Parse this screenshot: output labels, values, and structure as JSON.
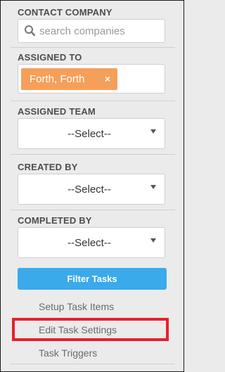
{
  "contact_company": {
    "label": "CONTACT COMPANY",
    "search_placeholder": "search companies"
  },
  "assigned_to": {
    "label": "ASSIGNED TO",
    "tag_label": "Forth, Forth",
    "tag_remove": "×"
  },
  "assigned_team": {
    "label": "ASSIGNED TEAM",
    "selected": "--Select--"
  },
  "created_by": {
    "label": "CREATED BY",
    "selected": "--Select--"
  },
  "completed_by": {
    "label": "COMPLETED BY",
    "selected": "--Select--"
  },
  "filter_button": "Filter Tasks",
  "links": [
    "Setup Task Items",
    "Edit Task Settings",
    "Task Triggers"
  ],
  "colors": {
    "accent": "#3aaaeb",
    "tag": "#f5a05a",
    "highlight": "#e8202a"
  }
}
